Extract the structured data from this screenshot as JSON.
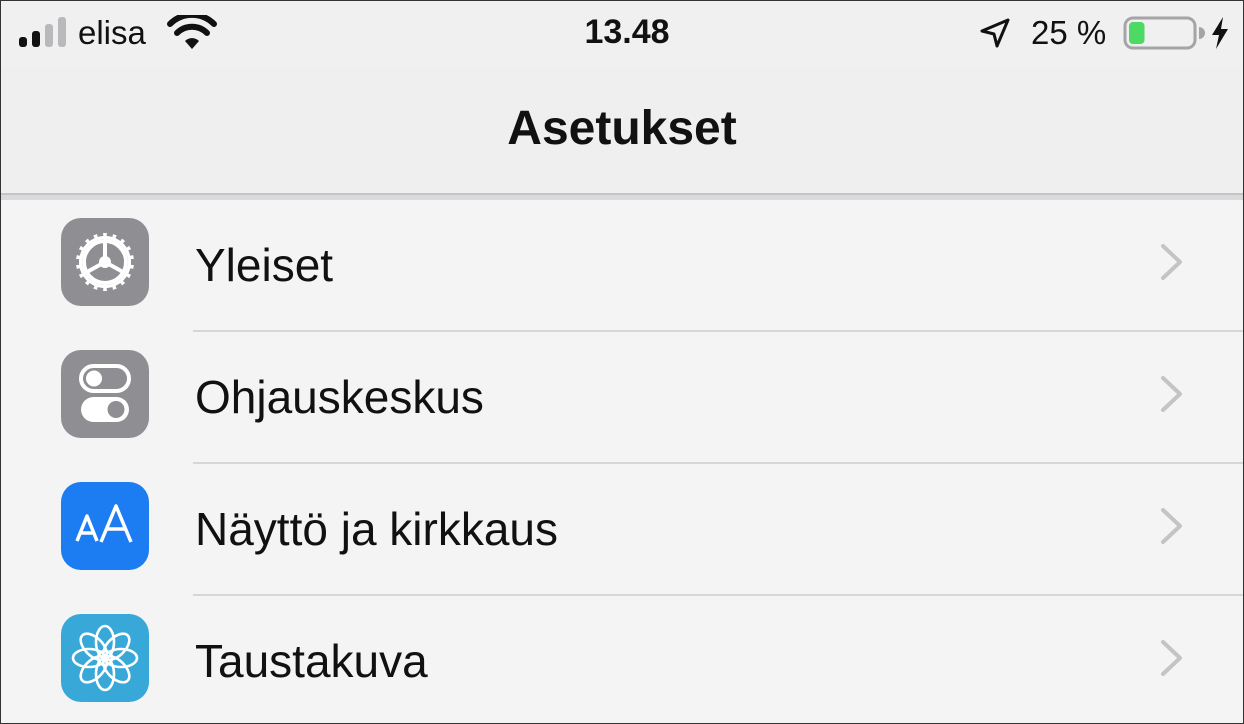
{
  "status_bar": {
    "carrier": "elisa",
    "time": "13.48",
    "battery_percent": "25 %",
    "battery_level": 0.25,
    "signal_bars": 2,
    "signal_bars_total": 4,
    "icons": [
      "signal-icon",
      "wifi-icon",
      "location-arrow-icon",
      "battery-icon",
      "charging-bolt-icon"
    ]
  },
  "nav": {
    "title": "Asetukset"
  },
  "settings": {
    "items": [
      {
        "label": "Yleiset",
        "icon": "gear-icon",
        "icon_color": "#8e8e93"
      },
      {
        "label": "Ohjauskeskus",
        "icon": "toggles-icon",
        "icon_color": "#8e8e93"
      },
      {
        "label": "Näyttö ja kirkkaus",
        "icon": "text-size-icon",
        "icon_color": "#1c7cf2"
      },
      {
        "label": "Taustakuva",
        "icon": "flower-icon",
        "icon_color": "#37a8d8"
      }
    ]
  },
  "colors": {
    "battery_fill": "#4cd964",
    "chevron": "#c4c4c7"
  }
}
